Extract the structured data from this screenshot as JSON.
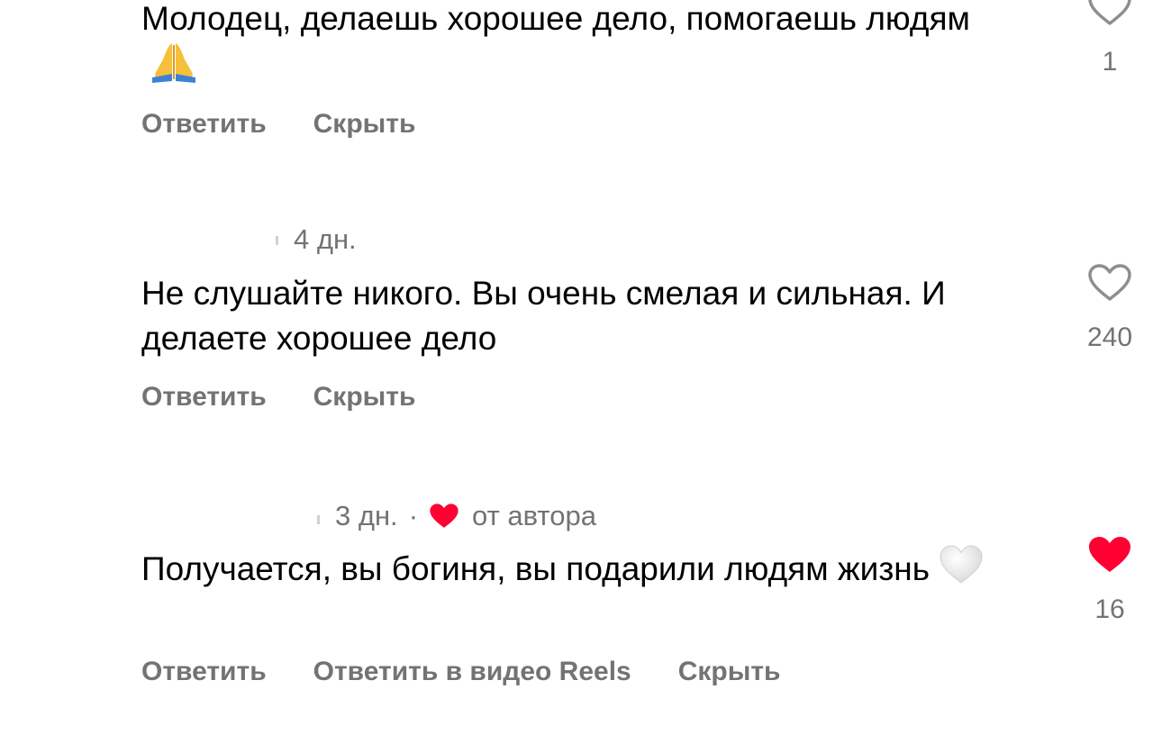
{
  "comments": [
    {
      "text": "Молодец, делаешь хорошее дело, помогаешь людям",
      "emoji": "folded-hands",
      "actions": {
        "reply": "Ответить",
        "hide": "Скрыть"
      },
      "like_count": "1",
      "liked": false
    },
    {
      "time": "4 дн.",
      "text": "Не слушайте никого. Вы очень смелая и сильная. И делаете хорошее дело",
      "actions": {
        "reply": "Ответить",
        "hide": "Скрыть"
      },
      "like_count": "240",
      "liked": false
    },
    {
      "time": "3 дн.",
      "separator": "·",
      "author_liked_label": "от автора",
      "text": "Получается, вы богиня, вы подарили людям жизнь",
      "emoji": "white-heart",
      "actions": {
        "reply": "Ответить",
        "reply_reels": "Ответить в видео Reels",
        "hide": "Скрыть"
      },
      "like_count": "16",
      "liked": true
    }
  ],
  "colors": {
    "text": "#000000",
    "muted": "#737373",
    "like_red": "#ff0033",
    "outline": "#8e8e8e"
  }
}
